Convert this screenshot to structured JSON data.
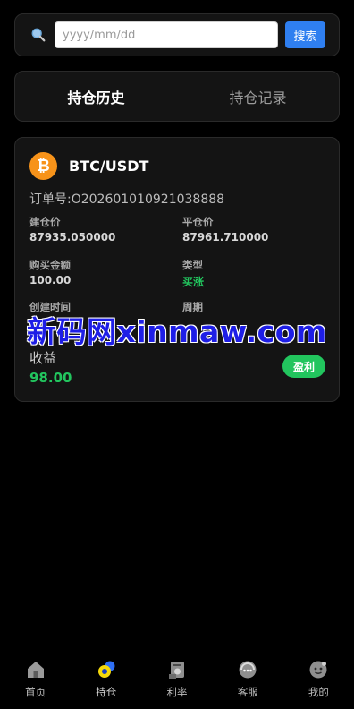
{
  "search": {
    "placeholder": "yyyy/mm/dd",
    "button_label": "搜索"
  },
  "tabs": [
    {
      "label": "持仓历史",
      "active": true
    },
    {
      "label": "持仓记录",
      "active": false
    }
  ],
  "order": {
    "pair": "BTC/USDT",
    "coin_icon": "bitcoin-icon",
    "coin_symbol": "₿",
    "order_no": "订单号:O202601010921038888",
    "open_price_label": "建仓价",
    "open_price": "87935.050000",
    "close_price_label": "平仓价",
    "close_price": "87961.710000",
    "amount_label": "购买金额",
    "amount": "100.00",
    "type_label": "类型",
    "type": "买涨",
    "created_label": "创建时间",
    "period_label": "周期",
    "profit_label": "收益",
    "profit": "98.00",
    "status": "盈利"
  },
  "watermark": "新码网xinmaw.com",
  "colors": {
    "accent_blue": "#2f7ff0",
    "profit_green": "#22c55e",
    "coin_orange": "#f7931a"
  },
  "nav": [
    {
      "label": "首页",
      "icon": "home-icon"
    },
    {
      "label": "持仓",
      "icon": "positions-icon",
      "active": true
    },
    {
      "label": "利率",
      "icon": "rate-icon"
    },
    {
      "label": "客服",
      "icon": "support-icon"
    },
    {
      "label": "我的",
      "icon": "profile-icon"
    }
  ]
}
